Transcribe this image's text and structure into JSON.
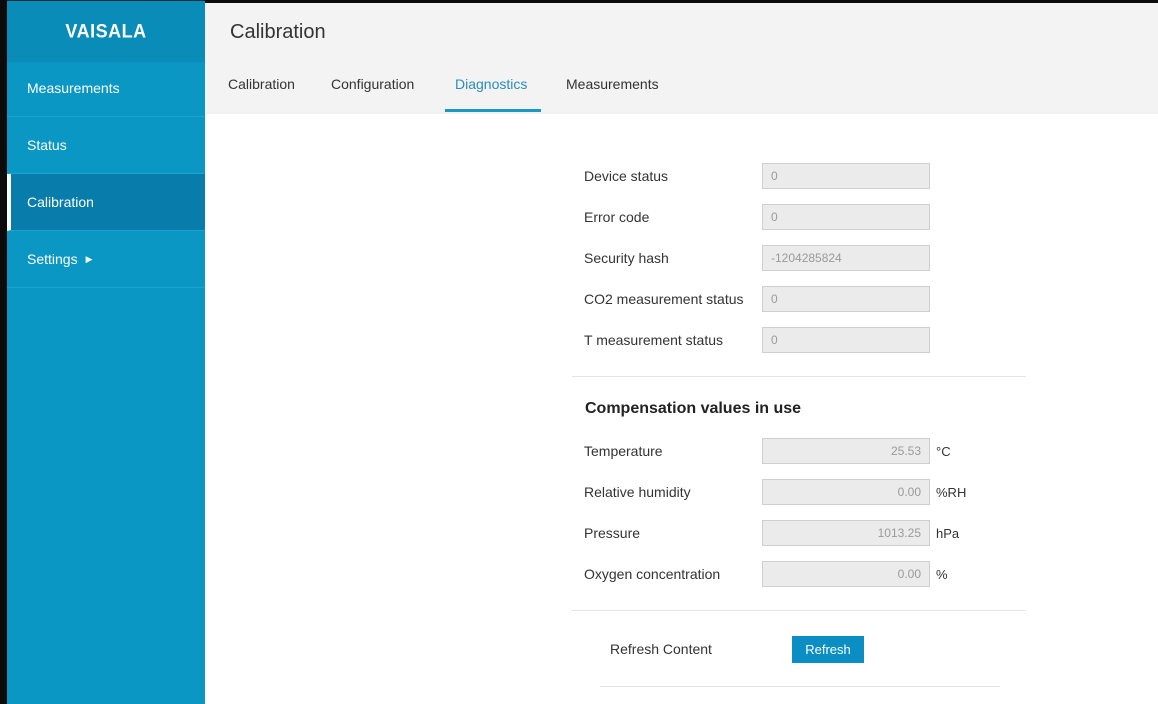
{
  "app": {
    "logo": "VAISALA"
  },
  "sidebar": {
    "items": [
      {
        "label": "Measurements"
      },
      {
        "label": "Status"
      },
      {
        "label": "Calibration",
        "active": true
      },
      {
        "label": "Settings",
        "has_submenu": true
      }
    ]
  },
  "header": {
    "title": "Calibration"
  },
  "tabs": [
    {
      "label": "Calibration"
    },
    {
      "label": "Configuration"
    },
    {
      "label": "Diagnostics",
      "active": true
    },
    {
      "label": "Measurements"
    }
  ],
  "diagnostics": {
    "device_status": {
      "label": "Device status",
      "value": "0"
    },
    "error_code": {
      "label": "Error code",
      "value": "0"
    },
    "security_hash": {
      "label": "Security hash",
      "value": "-1204285824"
    },
    "co2_status": {
      "label": "CO2 measurement status",
      "value": "0"
    },
    "t_status": {
      "label": "T measurement status",
      "value": "0"
    }
  },
  "compensation": {
    "title": "Compensation values in use",
    "temperature": {
      "label": "Temperature",
      "value": "25.53",
      "unit": "°C"
    },
    "humidity": {
      "label": "Relative humidity",
      "value": "0.00",
      "unit": "%RH"
    },
    "pressure": {
      "label": "Pressure",
      "value": "1013.25",
      "unit": "hPa"
    },
    "oxygen": {
      "label": "Oxygen concentration",
      "value": "0.00",
      "unit": "%"
    }
  },
  "refresh": {
    "label": "Refresh Content",
    "button": "Refresh"
  },
  "colors": {
    "sidebar": "#0a97c4",
    "sidebar_active": "#087cab",
    "accent": "#1a98c8"
  }
}
